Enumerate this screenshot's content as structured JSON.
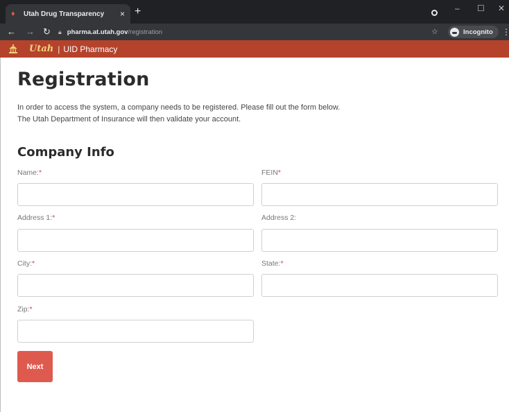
{
  "browser": {
    "tab_title": "Utah Drug Transparency",
    "tab_close": "×",
    "new_tab": "+",
    "url_host": "pharma.at.utah.gov",
    "url_path": "/registration",
    "incognito_label": "Incognito",
    "icons": [
      "back-arrow-icon",
      "forward-arrow-icon",
      "reload-icon",
      "lock-icon",
      "star-icon",
      "incognito-icon",
      "kebab-menu-icon",
      "minimize-icon",
      "maximize-icon",
      "close-icon"
    ]
  },
  "app": {
    "logo_text": "Utah",
    "separator": "|",
    "name": "UID Pharmacy",
    "header_color": "#b5432b"
  },
  "page": {
    "title": "Registration",
    "intro_line1": "In order to access the system, a company needs to be registered. Please fill out the form below.",
    "intro_line2": "The Utah Department of Insurance will then validate your account."
  },
  "form": {
    "section_title": "Company Info",
    "required_marker": "*",
    "fields": {
      "name": {
        "label": "Name:",
        "required": true,
        "value": ""
      },
      "fein": {
        "label": "FEIN",
        "required": true,
        "value": ""
      },
      "address1": {
        "label": "Address 1:",
        "required": true,
        "value": ""
      },
      "address2": {
        "label": "Address 2:",
        "required": false,
        "value": ""
      },
      "city": {
        "label": "City:",
        "required": true,
        "value": ""
      },
      "state": {
        "label": "State:",
        "required": true,
        "value": ""
      },
      "zip": {
        "label": "Zip:",
        "required": true,
        "value": ""
      }
    },
    "next_label": "Next",
    "button_color": "#df5a4e"
  }
}
